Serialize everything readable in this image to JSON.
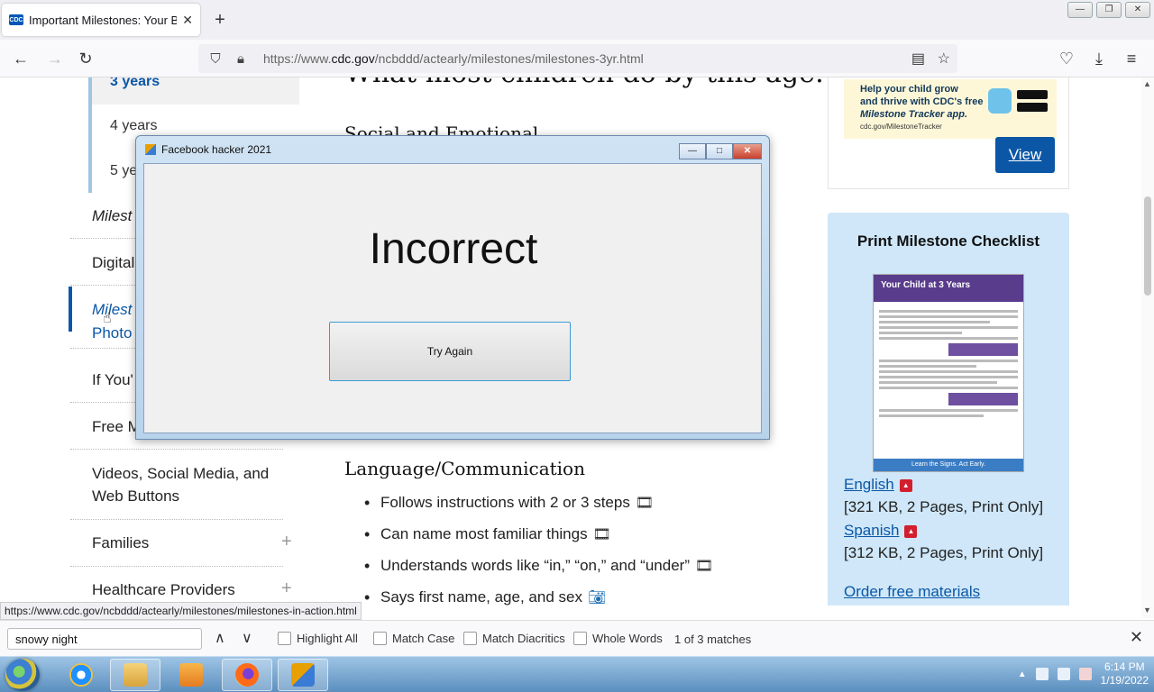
{
  "browser": {
    "tab_title": "Important Milestones: Your Bab",
    "tab_favicon": "CDC",
    "new_tab": "+",
    "url_prefix": "https://www.",
    "url_domain": "cdc.gov",
    "url_path": "/ncbddd/actearly/milestones/milestones-3yr.html"
  },
  "sidebar": {
    "sub_items": [
      "3 years",
      "4 years",
      "5 ye"
    ],
    "items": [
      "Milest",
      "Digital",
      "Milest",
      "Photo",
      "If You'",
      "Free M",
      "Videos, Social Media, and",
      "Web Buttons",
      "Families",
      "Healthcare Providers"
    ],
    "expand_symbol": "+"
  },
  "main": {
    "page_heading": "What most children do by this age:",
    "section_social": "Social and Emotional",
    "section_language": "Language/Communication",
    "language_items": [
      "Follows instructions with 2 or 3 steps",
      "Can name most familiar things",
      "Understands words like “in,” “on,” and “under”",
      "Says first name, age, and sex"
    ]
  },
  "right": {
    "promo_line1": "Help your child grow",
    "promo_line2": "and thrive with CDC's free",
    "promo_line3": "Milestone Tracker app.",
    "promo_url": "cdc.gov/MilestoneTracker",
    "view_label": "View",
    "checklist_title": "Print Milestone Checklist",
    "thumb_header": "Your Child at 3 Years",
    "thumb_footer": "Learn the Signs. Act Early.",
    "english_label": "English",
    "english_meta": "[321 KB, 2 Pages, Print Only]",
    "spanish_label": "Spanish",
    "spanish_meta": "[312 KB, 2 Pages, Print Only]",
    "order_label": "Order free materials"
  },
  "dialog": {
    "title": "Facebook hacker 2021",
    "message": "Incorrect",
    "button_label": "Try Again"
  },
  "status_link": "https://www.cdc.gov/ncbddd/actearly/milestones/milestones-in-action.html",
  "findbar": {
    "query": "snowy night",
    "highlight_all": "Highlight All",
    "match_case": "Match Case",
    "match_diacritics": "Match Diacritics",
    "whole_words": "Whole Words",
    "match_count": "1 of 3 matches"
  },
  "taskbar": {
    "time": "6:14 PM",
    "date": "1/19/2022"
  },
  "colors": {
    "link": "#0b57a6",
    "accent_bar": "#0b57a6",
    "checklist_bg": "#cfe7f8"
  }
}
